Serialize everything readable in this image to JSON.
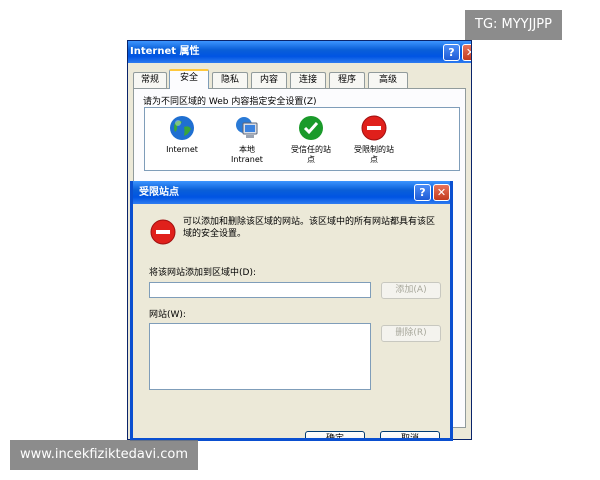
{
  "bg_window": {
    "title": "Internet 属性",
    "tabs": [
      "常规",
      "安全",
      "隐私",
      "内容",
      "连接",
      "程序",
      "高级"
    ],
    "zone_prompt": "请为不同区域的 Web 内容指定安全设置(Z)",
    "zones": [
      {
        "label": "Internet",
        "icon": "globe-icon"
      },
      {
        "label": "本地\nIntranet",
        "icon": "computer-icon"
      },
      {
        "label": "受信任的站\n点",
        "icon": "checkmark-icon"
      },
      {
        "label": "受限制的站\n点",
        "icon": "no-entry-icon"
      }
    ],
    "help_glyph": "?",
    "close_glyph": "✕"
  },
  "dialog": {
    "title": "受限站点",
    "description": "可以添加和删除该区域的网站。该区域中的所有网站都具有该区域的安全设置。",
    "add_label": "将该网站添加到区域中(D):",
    "add_value": "",
    "add_button": "添加(A)",
    "list_label": "网站(W):",
    "remove_button": "删除(R)",
    "ok_button": "确定",
    "cancel_button": "取消",
    "help_glyph": "?",
    "close_glyph": "✕",
    "icon": "no-entry-icon"
  },
  "watermarks": {
    "top_right": "TG: MYYJJPP",
    "bottom_left": "www.incekfiziktedavi.com"
  },
  "colors": {
    "titlebar": "#0054e3",
    "dialog_face": "#ece9d8",
    "restricted_red": "#e0201b",
    "trusted_green": "#1a9a2a"
  }
}
